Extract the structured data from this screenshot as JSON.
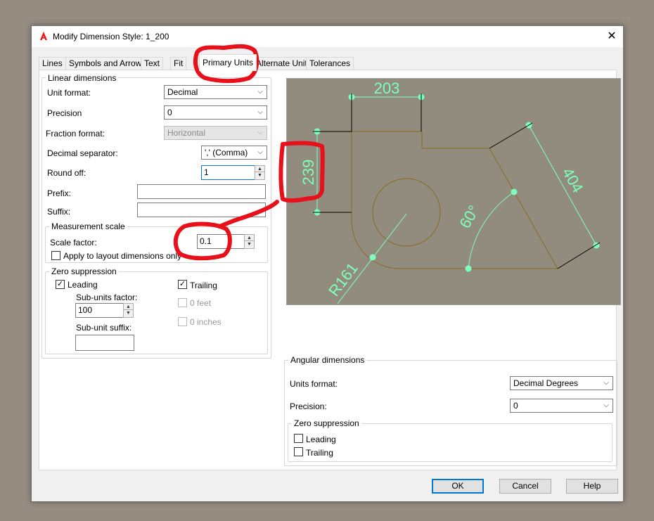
{
  "window": {
    "title": "Modify Dimension Style: 1_200",
    "close_glyph": "✕"
  },
  "tabs": [
    "Lines",
    "Symbols and Arrows",
    "Text",
    "Fit",
    "Primary Units",
    "Alternate Units",
    "Tolerances"
  ],
  "linear": {
    "group_label": "Linear dimensions",
    "unit_format_label": "Unit format:",
    "unit_format_value": "Decimal",
    "precision_label": "Precision",
    "precision_value": "0",
    "fraction_format_label": "Fraction format:",
    "fraction_format_value": "Horizontal",
    "decimal_separator_label": "Decimal separator:",
    "decimal_separator_value": "',' (Comma)",
    "round_off_label": "Round off:",
    "round_off_value": "1",
    "prefix_label": "Prefix:",
    "prefix_value": "",
    "suffix_label": "Suffix:",
    "suffix_value": ""
  },
  "measurement_scale": {
    "group_label": "Measurement scale",
    "scale_factor_label": "Scale factor:",
    "scale_factor_value": "0.1",
    "apply_layout_label": "Apply to layout dimensions only",
    "apply_layout_checked": false
  },
  "zero_suppression": {
    "group_label": "Zero suppression",
    "leading_label": "Leading",
    "leading_checked": true,
    "trailing_label": "Trailing",
    "trailing_checked": true,
    "sub_units_factor_label": "Sub-units factor:",
    "sub_units_factor_value": "100",
    "sub_unit_suffix_label": "Sub-unit suffix:",
    "sub_unit_suffix_value": "",
    "zero_feet_label": "0 feet",
    "zero_inches_label": "0 inches",
    "check_glyph": "✓"
  },
  "angular": {
    "group_label": "Angular dimensions",
    "units_format_label": "Units format:",
    "units_format_value": "Decimal Degrees",
    "precision_label": "Precision:",
    "precision_value": "0",
    "zero_group_label": "Zero suppression",
    "leading_label": "Leading",
    "trailing_label": "Trailing"
  },
  "preview": {
    "dim_203": "203",
    "dim_239": "239",
    "dim_404": "404",
    "dim_60": "60°",
    "dim_r161": "R161",
    "bg_color": "#928c7f",
    "dim_color": "#7dffc0",
    "geometry_color": "#8a6a1a"
  },
  "buttons": {
    "ok": "OK",
    "cancel": "Cancel",
    "help": "Help"
  },
  "annotation_color": "#e8101a",
  "chevron_glyph": "⌵",
  "spin_up_glyph": "▲",
  "spin_down_glyph": "▼"
}
